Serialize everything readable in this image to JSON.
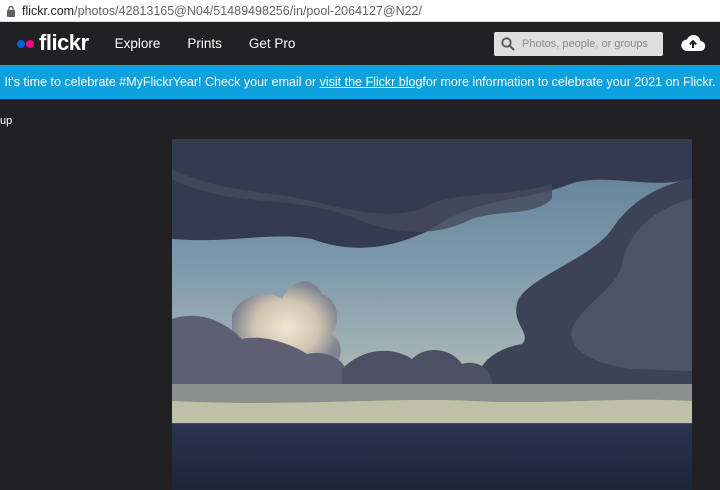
{
  "browser": {
    "url_host": "flickr.com",
    "url_path": "/photos/42813165@N04/51489498256/in/pool-2064127@N22/"
  },
  "header": {
    "logo": "flickr",
    "nav": [
      "Explore",
      "Prints",
      "Get Pro"
    ],
    "search_placeholder": "Photos, people, or groups"
  },
  "banner": {
    "text_before": "It's time to celebrate #MyFlickrYear! Check your email or ",
    "link": "visit the Flickr blog",
    "text_after": " for more information to celebrate your 2021 on Flickr."
  },
  "page": {
    "group_label": "up"
  },
  "colors": {
    "banner_bg": "#0ea1e0",
    "nav_bg": "#212124",
    "logo_blue": "#0063dc",
    "logo_pink": "#ff0084"
  }
}
